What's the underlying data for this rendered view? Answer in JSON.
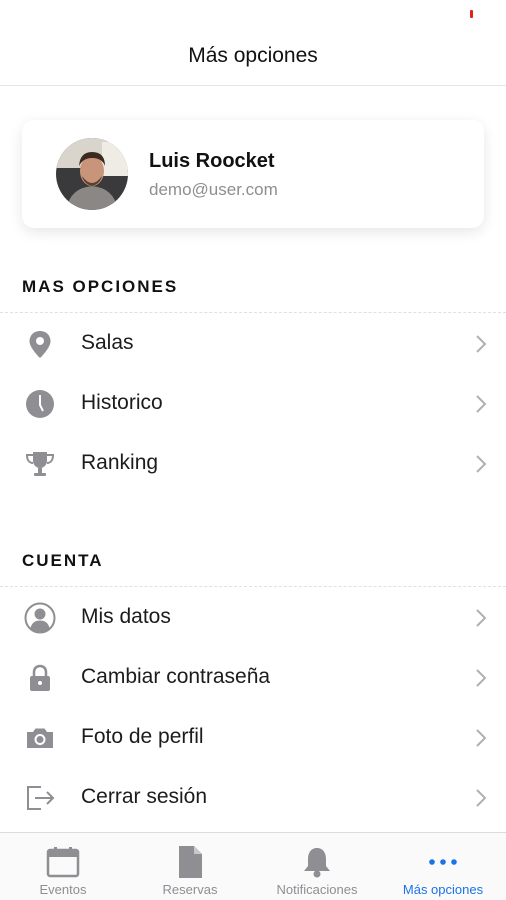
{
  "header": {
    "title": "Más opciones"
  },
  "profile": {
    "name": "Luis Roocket",
    "email": "demo@user.com"
  },
  "sections": [
    {
      "title": "MAS OPCIONES",
      "items": [
        {
          "label": "Salas",
          "icon": "location-pin-icon"
        },
        {
          "label": "Historico",
          "icon": "clock-icon"
        },
        {
          "label": "Ranking",
          "icon": "trophy-icon"
        }
      ]
    },
    {
      "title": "CUENTA",
      "items": [
        {
          "label": "Mis datos",
          "icon": "user-circle-icon"
        },
        {
          "label": "Cambiar contraseña",
          "icon": "lock-icon"
        },
        {
          "label": "Foto de perfil",
          "icon": "camera-icon"
        },
        {
          "label": "Cerrar sesión",
          "icon": "logout-icon"
        }
      ]
    }
  ],
  "tabs": [
    {
      "label": "Eventos",
      "icon": "calendar-icon",
      "active": false
    },
    {
      "label": "Reservas",
      "icon": "document-icon",
      "active": false
    },
    {
      "label": "Notificaciones",
      "icon": "bell-icon",
      "active": false
    },
    {
      "label": "Más opciones",
      "icon": "more-dots-icon",
      "active": true
    }
  ],
  "colors": {
    "accent": "#1a73e8",
    "icon_gray": "#8e8e93",
    "status_red": "#e0241b"
  }
}
